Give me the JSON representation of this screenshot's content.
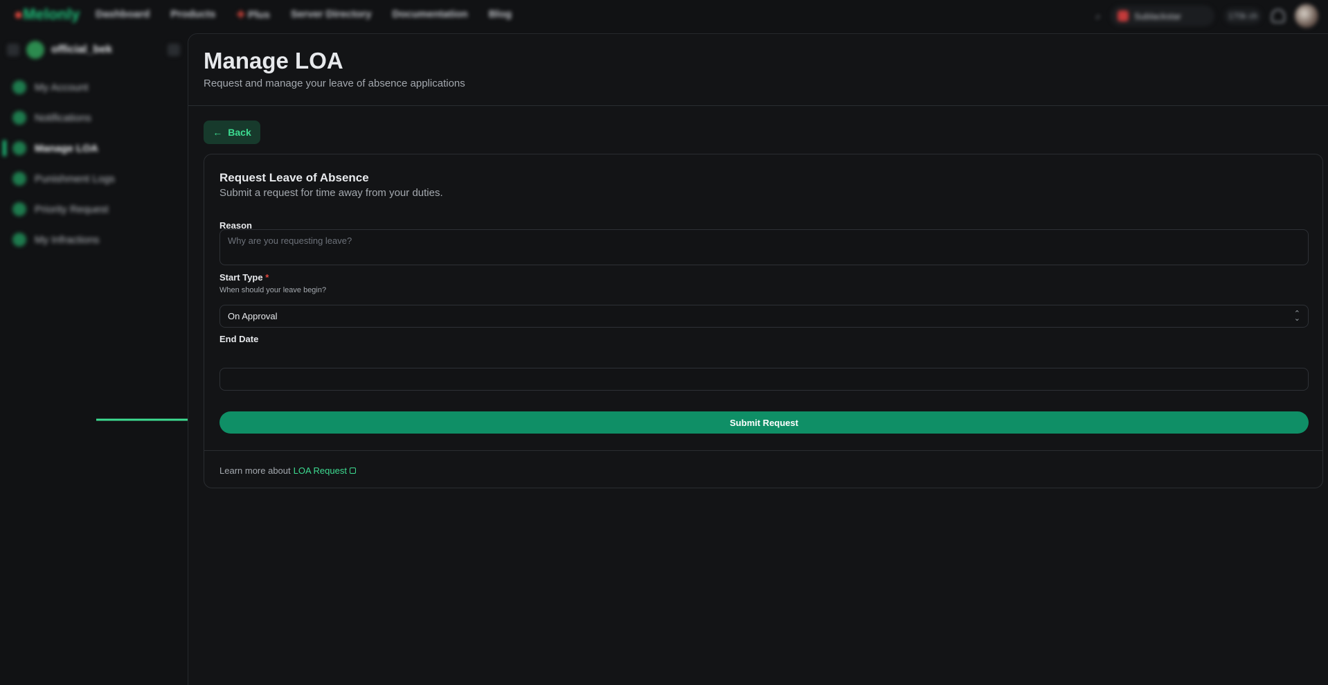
{
  "topnav": {
    "logo": "Melonly",
    "items": [
      "Dashboard",
      "Products",
      "Plus",
      "Server Directory",
      "Documentation",
      "Blog"
    ],
    "user_pill": "Sublackstar",
    "status_pill": "170k ch"
  },
  "sidebar": {
    "workspace": "official_bek",
    "items": [
      {
        "label": "My Account"
      },
      {
        "label": "Notifications"
      },
      {
        "label": "Manage LOA"
      },
      {
        "label": "Punishment Logs"
      },
      {
        "label": "Priority Request"
      },
      {
        "label": "My Infractions"
      }
    ],
    "active_index": 2
  },
  "page": {
    "title": "Manage LOA",
    "subtitle": "Request and manage your leave of absence applications"
  },
  "back": {
    "label": "Back"
  },
  "form": {
    "title": "Request Leave of Absence",
    "subtitle": "Submit a request for time away from your duties.",
    "reason_label": "Reason",
    "reason_placeholder": "Why are you requesting leave?",
    "start_type_label": "Start Type",
    "required_mark": "*",
    "start_type_hint": "When should your leave begin?",
    "start_type_value": "On Approval",
    "end_date_label": "End Date",
    "end_date_value": "",
    "submit_label": "Submit Request",
    "learn_prefix": "Learn more about",
    "learn_link": "LOA Request"
  },
  "colors": {
    "accent": "#1fbf7a",
    "submit_bg": "#0f8f66",
    "background": "#111214"
  }
}
